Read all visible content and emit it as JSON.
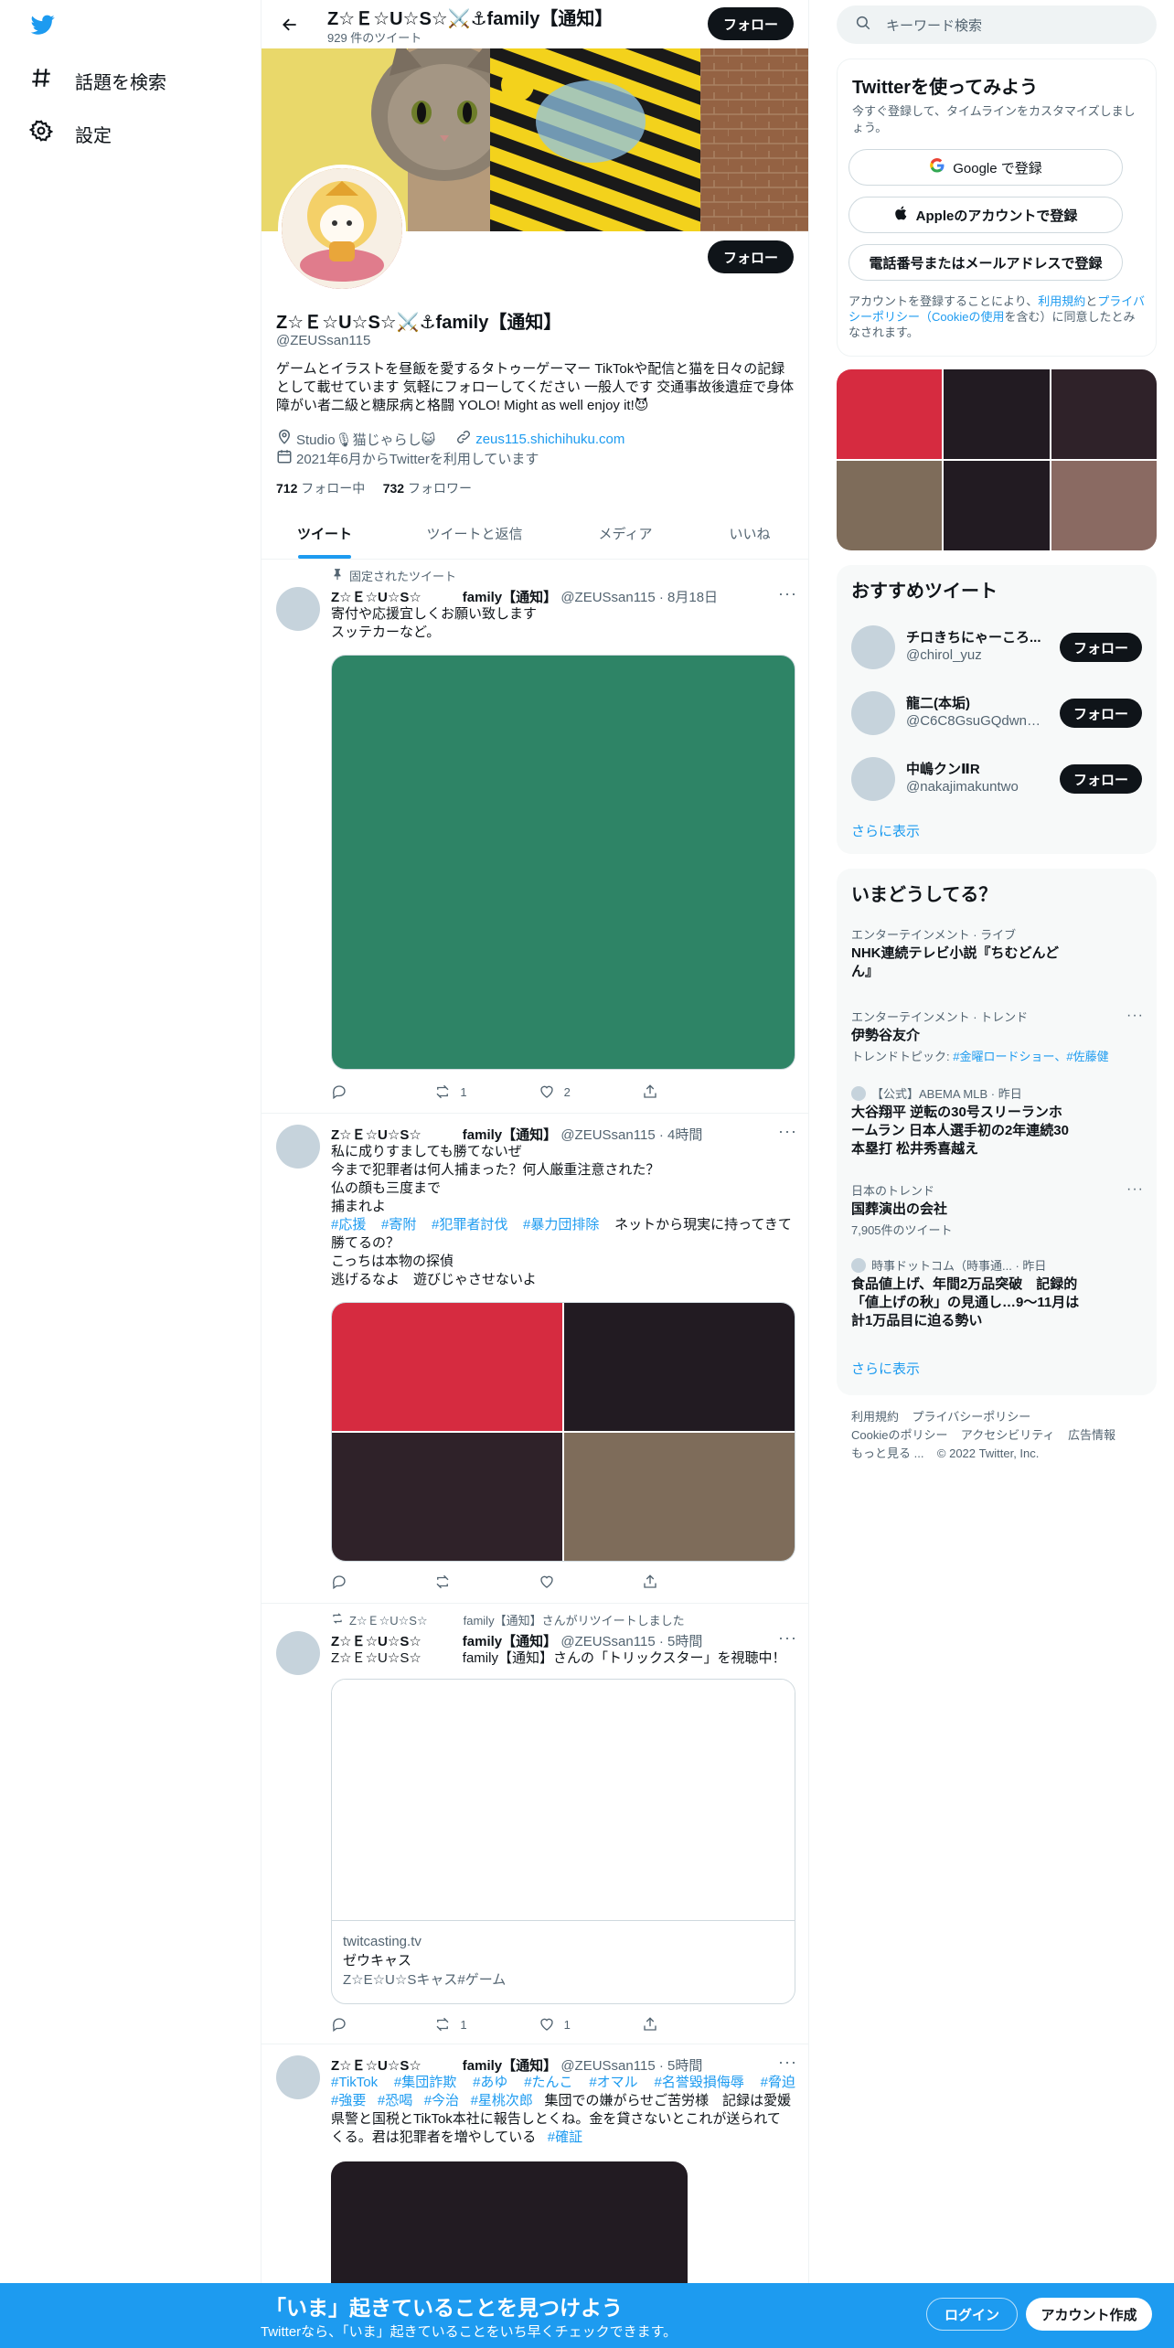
{
  "nav": {
    "logo": "twitter-bird",
    "items": [
      {
        "label": "話題を検索",
        "icon": "hashtag-icon"
      },
      {
        "label": "設定",
        "icon": "gear-icon"
      }
    ]
  },
  "header": {
    "name": "Z☆Ｅ☆U☆S☆⚔️⚓family【通知】",
    "tweet_count": "929 件のツイート",
    "follow_label": "フォロー"
  },
  "profile": {
    "name": "Z☆Ｅ☆U☆S☆⚔️⚓family【通知】",
    "handle": "@ZEUSsan115",
    "bio": "ゲームとイラストを昼飯を愛するタトゥーゲーマー TikTokや配信と猫を日々の記録として載せています 気軽にフォローしてください 一般人です 交通事故後遺症で身体障がい者二級と糖尿病と格闘 YOLO! Might as well enjoy it!😈",
    "location": "Studio🎙猫じゃらし😺",
    "website": "zeus115.shichihuku.com",
    "joined": "2021年6月からTwitterを利用しています",
    "following_count": "712",
    "following_label": "フォロー中",
    "followers_count": "732",
    "followers_label": "フォロワー",
    "follow_label": "フォロー"
  },
  "tabs": [
    "ツイート",
    "ツイートと返信",
    "メディア",
    "いいね"
  ],
  "tweets": [
    {
      "context": "固定されたツイート",
      "name": "Z☆Ｅ☆U☆S☆　　　family【通知】",
      "handle": "@ZEUSsan115",
      "time": "8月18日",
      "text": "寄付や応援宜しくお願い致します\nスッテカーなど。",
      "media_color": "#2e8466",
      "replies": "",
      "retweets": "1",
      "likes": "2"
    },
    {
      "name": "Z☆Ｅ☆U☆S☆　　　family【通知】",
      "handle": "@ZEUSsan115",
      "time": "4時間",
      "text_lines": [
        "私に成りすましても勝てないぜ",
        "今まで犯罪者は何人捕まった？何人厳重注意された？",
        "仏の顔も三度まで",
        "捕まれよ"
      ],
      "hashtags": [
        "#応援",
        "#寄附",
        "#犯罪者討伐",
        "#暴力団排除"
      ],
      "text_after": "ネットから現実に持ってきて勝てるの？\nこっちは本物の探偵\n逃げるなよ　遊びじゃさせないよ",
      "media_colors": [
        "#d62b40",
        "#221b22",
        "#2f2229",
        "#7e6c5a"
      ],
      "replies": "",
      "retweets": "",
      "likes": ""
    },
    {
      "context": "Z☆Ｅ☆U☆S☆　　　family【通知】さんがリツイートしました",
      "name": "Z☆Ｅ☆U☆S☆　　　family【通知】",
      "handle": "@ZEUSsan115",
      "time": "5時間",
      "text": "Z☆Ｅ☆U☆S☆　　　family【通知】さんの「トリックスター」を視聴中！",
      "card_domain": "twitcasting.tv",
      "card_title": "ゼウキャス",
      "card_desc": "Z☆E☆U☆Sキャス#ゲーム",
      "replies": "",
      "retweets": "1",
      "likes": "1"
    },
    {
      "name": "Z☆Ｅ☆U☆S☆　　　family【通知】",
      "handle": "@ZEUSsan115",
      "time": "5時間",
      "hashtags_line1": [
        "#TikTok",
        "#集団詐欺",
        "#あゆ",
        "#たんこ",
        "#オマル",
        "#名誉毀損侮辱",
        "#脅迫"
      ],
      "hashtags_line2": [
        "#強要",
        "#恐喝",
        "#今治",
        "#星桃次郎"
      ],
      "text_line2_after": "集団での嫌がらせご苦労様　記録は愛媛",
      "text_line3": "県警と国税とTikTok本社に報告しとくね。金を貸さないとこれが送られて",
      "text_line4": "くる。君は犯罪者を増やしている",
      "last_hashtag": "#確証",
      "media_color": "#221b22"
    }
  ],
  "right": {
    "search_placeholder": "キーワード検索",
    "signup": {
      "title": "Twitterを使ってみよう",
      "subtitle": "今すぐ登録して、タイムラインをカスタマイズしましょう。",
      "google": "Google で登録",
      "apple": "Appleのアカウントで登録",
      "phone": "電話番号またはメールアドレスで登録",
      "terms_pre": "アカウントを登録することにより、",
      "terms_link": "利用規約",
      "and": "と",
      "privacy_link": "プライバシーポリシー（Cookieの使用",
      "terms_post": "を含む）に同意したとみなされます。"
    },
    "media_grid_colors": [
      "#d62b40",
      "#221b22",
      "#2f2229",
      "#7e6c5a",
      "#221b22",
      "#8a6a62"
    ],
    "recommended": {
      "title": "おすすめツイート",
      "users": [
        {
          "name": "チロきちにゃーころ...",
          "handle": "@chirol_yuz",
          "follow": "フォロー"
        },
        {
          "name": "龍二(本垢)",
          "handle": "@C6C8GsuGQdwnu...",
          "follow": "フォロー"
        },
        {
          "name": "中嶋クンⅡR",
          "handle": "@nakajimakuntwo",
          "follow": "フォロー"
        }
      ],
      "more": "さらに表示"
    },
    "trends": {
      "title": "いまどうしてる？",
      "items": [
        {
          "category": "エンターテインメント · ライブ",
          "title": "NHK連続テレビ小説『ちむどんどん』",
          "sub": ""
        },
        {
          "category": "エンターテインメント · トレンド",
          "title": "伊勢谷友介",
          "sub_prefix": "トレンドトピック: ",
          "sub_links": "#金曜ロードショー、#佐藤健"
        },
        {
          "category": "【公式】ABEMA MLB · 昨日",
          "title": "大谷翔平 逆転の30号スリーランホームラン 日本人選手初の2年連続30本塁打 松井秀喜越え",
          "sub": ""
        },
        {
          "category": "日本のトレンド",
          "title": "国葬演出の会社",
          "sub": "7,905件のツイート"
        },
        {
          "category": "時事ドットコム（時事通... · 昨日",
          "title": "食品値上げ、年間2万品突破　記録的「値上げの秋」の見通し…9～11月は計1万品目に迫る勢い",
          "sub": ""
        }
      ],
      "more": "さらに表示"
    },
    "footer": [
      "利用規約",
      "プライバシーポリシー",
      "Cookieのポリシー",
      "アクセシビリティ",
      "広告情報",
      "もっと見る ...",
      "© 2022 Twitter, Inc."
    ]
  },
  "bottom_bar": {
    "title": "「いま」起きていることを見つけよう",
    "subtitle": "Twitterなら、「いま」起きていることをいち早くチェックできます。",
    "login": "ログイン",
    "signup": "アカウント作成"
  },
  "colors": {
    "accent": "#1d9bf0",
    "text": "#0f1419",
    "secondary": "#536471"
  }
}
